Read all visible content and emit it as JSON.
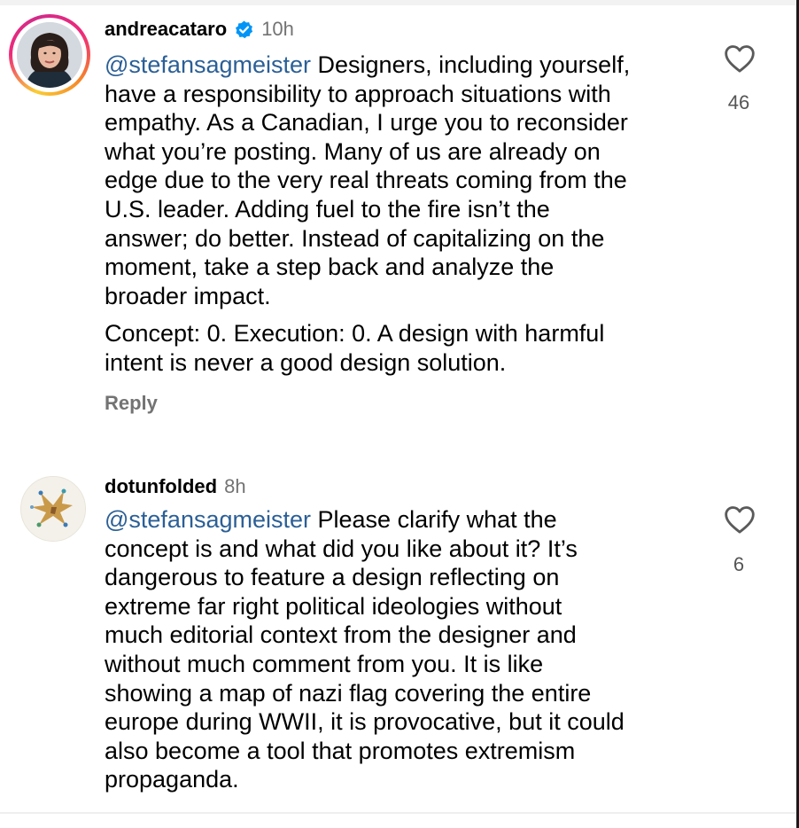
{
  "comments": [
    {
      "username": "andreacataro",
      "verified": true,
      "timestamp": "10h",
      "mention": "@stefansagmeister",
      "text_lines": [
        " Designers, including yourself,\nhave a responsibility to approach situations with\nempathy. As a Canadian, I urge you to reconsider\nwhat you’re posting. Many of us are already on\nedge due to the very real threats coming from the\nU.S. leader. Adding fuel to the fire isn’t the\nanswer; do better. Instead of capitalizing on the\nmoment, take a step back and analyze the\nbroader impact."
      ],
      "paragraph2": "Concept: 0. Execution: 0. A design with harmful\nintent is never a good design solution.",
      "reply_label": "Reply",
      "like_count": "46",
      "has_story_ring": true
    },
    {
      "username": "dotunfolded",
      "verified": false,
      "timestamp": "8h",
      "mention": "@stefansagmeister",
      "text": " Please clarify what the\nconcept is and what did you like about it? It’s\ndangerous to feature a design reflecting on\nextreme far right political ideologies without\nmuch editorial context from the designer and\nwithout much comment from you. It is like\nshowing a map of nazi flag covering the entire\neurope during WWII, it is provocative, but it could\nalso become a tool that promotes extremism\npropaganda.",
      "like_count": "6",
      "has_story_ring": false
    }
  ],
  "colors": {
    "mention": "#2b5f96",
    "secondary_text": "#737373",
    "verified_badge": "#0095f6"
  },
  "icons": {
    "like": "heart-outline-icon",
    "verified": "verified-badge-icon"
  }
}
